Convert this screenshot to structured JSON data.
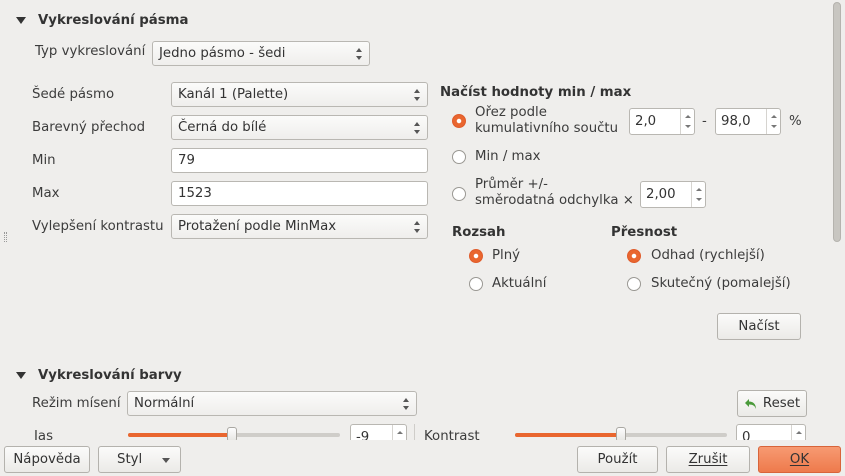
{
  "band_rendering": {
    "title": "Vykreslování pásma",
    "render_type_label": "Typ vykreslování",
    "render_type_value": "Jedno pásmo - šedi",
    "gray_band_label": "Šedé pásmo",
    "gray_band_value": "Kanál 1 (Palette)",
    "color_gradient_label": "Barevný přechod",
    "color_gradient_value": "Černá do bílé",
    "min_label": "Min",
    "min_value": "79",
    "max_label": "Max",
    "max_value": "1523",
    "contrast_label": "Vylepšení kontrastu",
    "contrast_value": "Protažení podle MinMax"
  },
  "minmax": {
    "title": "Načíst hodnoty min / max",
    "cumulative_line1": "Ořez podle",
    "cumulative_line2": "kumulativního součtu",
    "cumulative_low": "2,0",
    "dash": "-",
    "cumulative_high": "98,0",
    "percent": "%",
    "minmax_label": "Min / max",
    "stddev_line1": "Průměr +/-",
    "stddev_line2": "směrodatná odchylka ×",
    "stddev_value": "2,00",
    "extent_title": "Rozsah",
    "extent_full": "Plný",
    "extent_current": "Aktuální",
    "accuracy_title": "Přesnost",
    "accuracy_estimate": "Odhad (rychlejší)",
    "accuracy_actual": "Skutečný (pomalejší)",
    "load_button": "Načíst"
  },
  "color_rendering": {
    "title": "Vykreslování barvy",
    "blend_label": "Režim mísení",
    "blend_value": "Normální",
    "reset_button": "Reset",
    "brightness_label": "Jas",
    "brightness_value": "-9",
    "contrast_label": "Kontrast",
    "contrast_value": "0"
  },
  "footer": {
    "help": "Nápověda",
    "style": "Styl",
    "apply": "Použít",
    "cancel": "Zrušit",
    "ok": "OK"
  },
  "colors": {
    "accent": "#e9662f",
    "background": "#efeeec"
  },
  "sliders": {
    "brightness_fraction": 0.49,
    "contrast_fraction": 0.5
  }
}
